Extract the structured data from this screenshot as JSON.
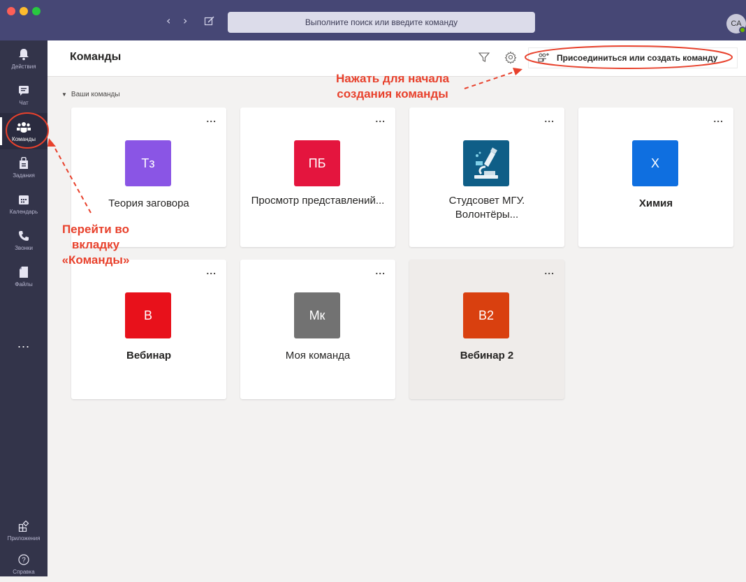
{
  "window": {
    "search_placeholder": "Выполните поиск или введите команду",
    "avatar_initials": "CA"
  },
  "rail": {
    "items": [
      {
        "label": "Действия",
        "icon": "bell-icon"
      },
      {
        "label": "Чат",
        "icon": "chat-icon"
      },
      {
        "label": "Команды",
        "icon": "teams-icon",
        "active": true
      },
      {
        "label": "Задания",
        "icon": "assignments-icon"
      },
      {
        "label": "Календарь",
        "icon": "calendar-icon"
      },
      {
        "label": "Звонки",
        "icon": "phone-icon"
      },
      {
        "label": "Файлы",
        "icon": "files-icon"
      }
    ],
    "more": "...",
    "apps_label": "Приложения",
    "help_label": "Справка"
  },
  "header": {
    "title": "Команды",
    "join_button_label": "Присоединиться или создать команду"
  },
  "section": {
    "label": "Ваши команды"
  },
  "teams": [
    {
      "initials": "Тз",
      "name": "Теория заговора",
      "color": "#8a55e5"
    },
    {
      "initials": "ПБ",
      "name": "Просмотр представлений...",
      "color": "#e4153e"
    },
    {
      "initials": "",
      "name": "Студсовет МГУ. Волонтёры...",
      "color": "#0f5e87",
      "icon": "microscope-icon"
    },
    {
      "initials": "Х",
      "name": "Химия",
      "color": "#0f6fe0"
    },
    {
      "initials": "В",
      "name": "Вебинар",
      "color": "#e8111b"
    },
    {
      "initials": "Мк",
      "name": "Моя команда",
      "color": "#727272"
    },
    {
      "initials": "В2",
      "name": "Вебинар 2",
      "color": "#d9400f"
    }
  ],
  "more_label": "...",
  "annotations": {
    "create_hint": "Нажать для начала создания команды",
    "create_hint_line1": "Нажать для начала",
    "create_hint_line2": "создания команды",
    "tab_hint_line1": "Перейти во",
    "tab_hint_line2": "вкладку",
    "tab_hint_line3": "«Команды»"
  },
  "colors": {
    "titlebar": "#464775",
    "rail": "#33344a",
    "annotation": "#e8412c"
  }
}
